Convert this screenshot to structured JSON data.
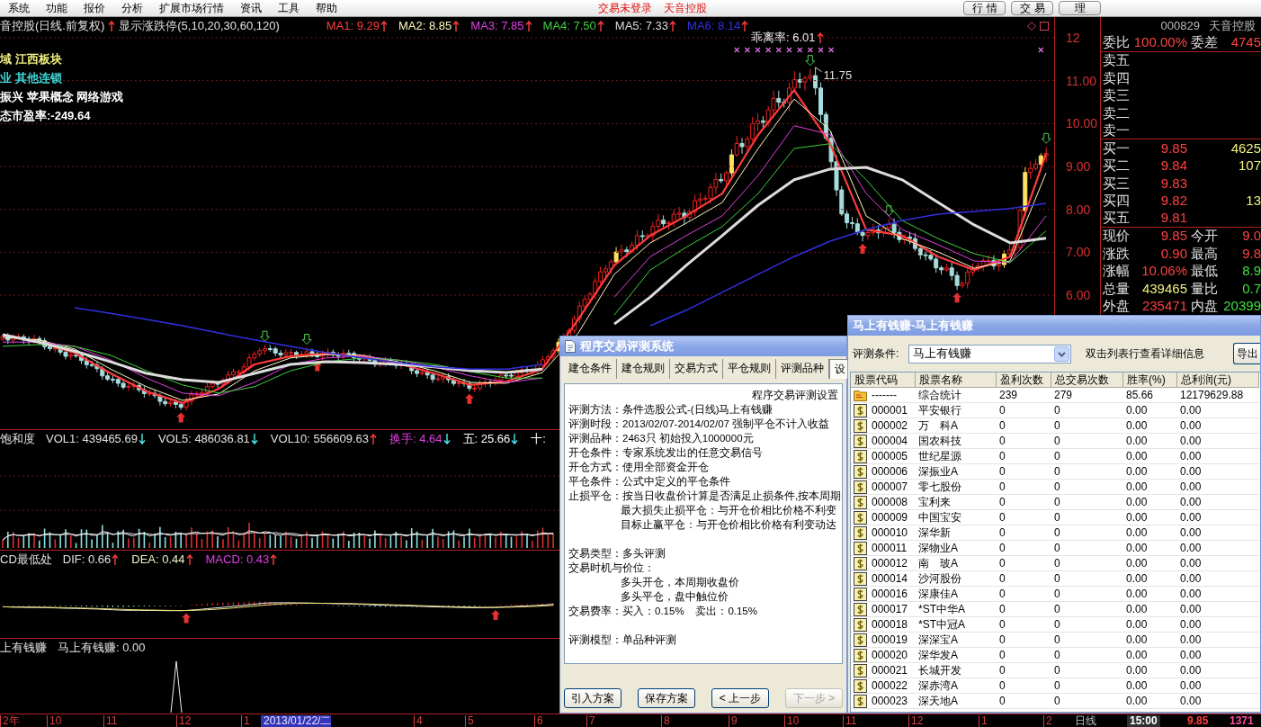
{
  "menu_bar": {
    "items": [
      "系统",
      "功能",
      "报价",
      "分析",
      "扩展市场行情",
      "资讯",
      "工具",
      "帮助"
    ],
    "notices": [
      "交易未登录",
      "天音控股"
    ],
    "buttons": [
      "行情",
      "交易",
      "理"
    ]
  },
  "chart": {
    "title": "音控股(日线.前复权)",
    "indicator_rising": true,
    "indicator": "显示涨跌停(5,10,20,30,60,120)",
    "moving_averages": [
      {
        "text": "MA1: 9.29",
        "rising": true,
        "color": "#ff3c3c"
      },
      {
        "text": "MA2: 8.85",
        "rising": true,
        "color": "#fff8c0"
      },
      {
        "text": "MA3: 7.85",
        "rising": true,
        "color": "#e040e0"
      },
      {
        "text": "MA4: 7.50",
        "rising": true,
        "color": "#40d040"
      },
      {
        "text": "MA5: 7.33",
        "rising": true,
        "color": "#dcdcdc"
      },
      {
        "text": "MA6: 8.14",
        "rising": true,
        "color": "#3030e0"
      }
    ],
    "info_lines": [
      {
        "text": "域 江西板块",
        "color": "#f0f080"
      },
      {
        "text": "业 其他连锁",
        "color": "#40d8d8"
      },
      {
        "text": "振兴 苹果概念 网络游戏",
        "color": "#ffffff"
      },
      {
        "text": "态市盈率:-249.64",
        "color": "#ffffff"
      }
    ],
    "bias": {
      "text": "乖离率: 6.01",
      "rising": true
    },
    "peak_label": "11.75",
    "chart_data": {
      "type": "line",
      "grid": true,
      "ylim": [
        2.88,
        12.48
      ],
      "yticks": [
        {
          "value": 12,
          "label": "12"
        },
        {
          "value": 11,
          "label": "11.00"
        },
        {
          "value": 10,
          "label": "10.00"
        },
        {
          "value": 9,
          "label": "9.00"
        },
        {
          "value": 8,
          "label": "8.00"
        },
        {
          "value": 7,
          "label": "7.00"
        },
        {
          "value": 6,
          "label": "6.00"
        }
      ],
      "series": [
        {
          "color": "#ff3c3c",
          "values": [
            5.08,
            4.91,
            4.66,
            4.18,
            3.76,
            3.49,
            3.82,
            4.39,
            4.58,
            4.64,
            4.58,
            4.41,
            4.18,
            3.91,
            3.99,
            4.28,
            5.44,
            6.7,
            7.39,
            7.85,
            8.37,
            9.74,
            10.78,
            9.53,
            7.53,
            7.39,
            6.9,
            6.59,
            6.9,
            9.29
          ]
        },
        {
          "color": "#fff8c0",
          "values": [
            5.02,
            4.96,
            4.75,
            4.28,
            3.87,
            3.55,
            3.7,
            4.24,
            4.54,
            4.62,
            4.6,
            4.45,
            4.24,
            3.97,
            3.95,
            4.2,
            5.12,
            6.49,
            7.22,
            7.68,
            8.16,
            9.42,
            10.57,
            9.84,
            7.85,
            7.32,
            7.01,
            6.63,
            6.8,
            8.85
          ]
        },
        {
          "color": "#e040e0",
          "values": [
            4.91,
            4.91,
            4.81,
            4.49,
            4.07,
            3.72,
            3.66,
            3.97,
            4.39,
            4.54,
            4.58,
            4.49,
            4.33,
            4.12,
            3.97,
            4.07,
            null,
            5.96,
            6.9,
            7.39,
            7.85,
            8.79,
            9.95,
            9.74,
            8.37,
            7.53,
            7.18,
            6.8,
            6.76,
            7.85
          ]
        },
        {
          "color": "#40d040",
          "values": [
            4.81,
            4.85,
            4.81,
            4.6,
            4.24,
            3.91,
            3.72,
            3.87,
            4.24,
            4.45,
            4.54,
            4.49,
            4.39,
            4.22,
            4.07,
            4.07,
            null,
            5.54,
            6.59,
            7.12,
            7.6,
            8.37,
            9.42,
            9.53,
            8.69,
            7.74,
            7.32,
            6.97,
            6.76,
            7.5
          ]
        },
        {
          "color": "#dcdcdc",
          "values": [
            5.08,
            4.91,
            4.7,
            4.45,
            4.18,
            4.03,
            3.97,
            4.18,
            4.39,
            4.45,
            4.43,
            4.39,
            4.33,
            4.24,
            4.2,
            4.28,
            null,
            5.33,
            5.96,
            6.7,
            7.39,
            8.1,
            8.69,
            8.94,
            8.98,
            8.69,
            8.16,
            7.64,
            7.22,
            7.33
          ]
        },
        {
          "color": "#3030e0",
          "values": [
            null,
            null,
            5.71,
            5.58,
            5.44,
            5.29,
            5.12,
            4.96,
            4.81,
            4.66,
            4.54,
            4.43,
            4.33,
            4.28,
            4.28,
            4.39,
            null,
            null,
            5.29,
            5.65,
            6.07,
            6.49,
            6.9,
            7.26,
            7.53,
            7.74,
            7.89,
            7.95,
            8.02,
            8.14
          ]
        }
      ]
    }
  },
  "volume_pane": {
    "title": "饱和度",
    "readouts": [
      {
        "text": "VOL1: 439465.69",
        "rising": false,
        "color": "#e0e0e0"
      },
      {
        "text": "VOL5: 486036.81",
        "rising": false,
        "color": "#e0e0e0"
      },
      {
        "text": "VOL10: 556609.63",
        "rising": true,
        "color": "#e0e0e0"
      },
      {
        "text": "换手: 4.64",
        "rising": false,
        "color": "#e040e0"
      },
      {
        "text": "五: 25.66",
        "rising": false,
        "color": "#ffffff"
      },
      {
        "text": "十:",
        "color": "#ffffff"
      }
    ]
  },
  "macd_pane": {
    "title": "CD最低处",
    "readouts": [
      {
        "text": "DIF: 0.66",
        "rising": true,
        "color": "#e0e0e0"
      },
      {
        "text": "DEA: 0.44",
        "rising": true,
        "color": "#f0f0c0"
      },
      {
        "text": "MACD: 0.43",
        "rising": true,
        "color": "#e040e0"
      }
    ]
  },
  "signal_pane": {
    "title": "上有钱赚",
    "readouts": [
      {
        "text": "马上有钱赚: 0.00",
        "color": "#e0e0e0"
      }
    ]
  },
  "quote_panel": {
    "code": "000829",
    "name": "天音控股",
    "order_ratio": [
      {
        "label": "委比",
        "value": "100.00%"
      },
      {
        "label": "委差",
        "value": "4745"
      }
    ],
    "asks": [
      "卖五",
      "卖四",
      "卖三",
      "卖二",
      "卖一"
    ],
    "bids": [
      {
        "label": "买一",
        "price": "9.85",
        "volume": "4625"
      },
      {
        "label": "买二",
        "price": "9.84",
        "volume": "107"
      },
      {
        "label": "买三",
        "price": "9.83"
      },
      {
        "label": "买四",
        "price": "9.82",
        "volume": "13"
      },
      {
        "label": "买五",
        "price": "9.81"
      }
    ],
    "stats": [
      {
        "label": "现价",
        "value": "9.85",
        "color": "#ff4040"
      },
      {
        "label": "今开",
        "value": "9.0",
        "color": "#ff4040"
      },
      {
        "label": "涨跌",
        "value": "0.90",
        "color": "#ff4040"
      },
      {
        "label": "最高",
        "value": "9.8",
        "color": "#ff4040"
      },
      {
        "label": "涨幅",
        "value": "10.06%",
        "color": "#ff4040"
      },
      {
        "label": "最低",
        "value": "8.9",
        "color": "#40e040"
      },
      {
        "label": "总量",
        "value": "439465",
        "color": "#f0f080"
      },
      {
        "label": "量比",
        "value": "0.7",
        "color": "#40e040"
      },
      {
        "label": "外盘",
        "value": "235471",
        "color": "#ff4040"
      },
      {
        "label": "内盘",
        "value": "20399",
        "color": "#40e040"
      }
    ]
  },
  "date_axis": {
    "labels": [
      {
        "text": "2年",
        "selected": false
      },
      {
        "text": "10",
        "selected": false
      },
      {
        "text": "11",
        "selected": false
      },
      {
        "text": "12",
        "selected": false
      },
      {
        "text": "1",
        "selected": false
      },
      {
        "text": "2013/01/22/二",
        "selected": true
      },
      {
        "text": "4",
        "selected": false
      },
      {
        "text": "5",
        "selected": false
      },
      {
        "text": "6",
        "selected": false
      },
      {
        "text": "7",
        "selected": false
      },
      {
        "text": "8",
        "selected": false
      },
      {
        "text": "9",
        "selected": false
      },
      {
        "text": "10",
        "selected": false
      },
      {
        "text": "11",
        "selected": false
      },
      {
        "text": "12",
        "selected": false
      },
      {
        "text": "1",
        "selected": false
      },
      {
        "text": "2",
        "selected": false
      }
    ],
    "status": {
      "period": "日线",
      "time": "15:00",
      "price": "9.85",
      "volume": "1371"
    }
  },
  "backtest_dialog": {
    "title": "程序交易评测系统",
    "tabs": [
      {
        "label": "建仓条件",
        "selected": false
      },
      {
        "label": "建仓规则",
        "selected": false
      },
      {
        "label": "交易方式",
        "selected": false
      },
      {
        "label": "平仓规则",
        "selected": false
      },
      {
        "label": "评测品种",
        "selected": false
      },
      {
        "label": "设",
        "selected": true
      }
    ],
    "report": {
      "title": "程序交易评测设置",
      "sections": [
        [
          {
            "text": "评测方法：条件选股公式-(日线)马上有钱赚"
          },
          {
            "text": "评测时段：2013/02/07-2014/02/07 强制平仓不计入收益"
          },
          {
            "text": "评测品种：2463只 初始投入1000000元"
          },
          {
            "text": "开仓条件：专家系统发出的任意交易信号"
          },
          {
            "text": "开仓方式：使用全部资金开仓"
          },
          {
            "text": "平仓条件：公式中定义的平仓条件"
          },
          {
            "text": "止损平仓：按当日收盘价计算是否满足止损条件,按本周期",
            "children": [
              {
                "text": "最大损失止损平仓：与开仓价相比价格不利变"
              },
              {
                "text": "目标止赢平仓：与开仓价相比价格有利变动达"
              }
            ]
          }
        ],
        [
          {
            "text": "交易类型：多头评测"
          },
          {
            "text": "交易时机与价位：",
            "children": [
              {
                "text": "多头开仓，本周期收盘价"
              },
              {
                "text": "多头平仓，盘中触位价"
              }
            ]
          },
          {
            "text": "交易费率：买入：0.15%    卖出：0.15%"
          }
        ],
        [
          {
            "text": "评测模型：单品种评测"
          }
        ]
      ]
    },
    "buttons": [
      {
        "label": "引入方案",
        "disabled": false
      },
      {
        "label": "保存方案",
        "disabled": false
      },
      {
        "label": "< 上一步",
        "disabled": false
      },
      {
        "label": "下一步 >",
        "disabled": true
      }
    ]
  },
  "results_window": {
    "title": "马上有钱赚-马上有钱赚",
    "filter": {
      "label": "评测条件:",
      "value": "马上有钱赚"
    },
    "hint": "双击列表行查看详细信息",
    "export_button": "导出",
    "columns": [
      "股票代码",
      "股票名称",
      "盈利次数",
      "总交易次数",
      "胜率(%)",
      "总利润(元)"
    ],
    "rows": [
      {
        "kind": "summary",
        "cells": [
          "-------",
          "综合统计",
          "239",
          "279",
          "85.66",
          "12179629.88"
        ]
      },
      {
        "kind": "stock",
        "cells": [
          "000001",
          "平安银行",
          "0",
          "0",
          "0.00",
          "0.00"
        ]
      },
      {
        "kind": "stock",
        "cells": [
          "000002",
          "万　科A",
          "0",
          "0",
          "0.00",
          "0.00"
        ]
      },
      {
        "kind": "stock",
        "cells": [
          "000004",
          "国农科技",
          "0",
          "0",
          "0.00",
          "0.00"
        ]
      },
      {
        "kind": "stock",
        "cells": [
          "000005",
          "世纪星源",
          "0",
          "0",
          "0.00",
          "0.00"
        ]
      },
      {
        "kind": "stock",
        "cells": [
          "000006",
          "深振业A",
          "0",
          "0",
          "0.00",
          "0.00"
        ]
      },
      {
        "kind": "stock",
        "cells": [
          "000007",
          "零七股份",
          "0",
          "0",
          "0.00",
          "0.00"
        ]
      },
      {
        "kind": "stock",
        "cells": [
          "000008",
          "宝利来",
          "0",
          "0",
          "0.00",
          "0.00"
        ]
      },
      {
        "kind": "stock",
        "cells": [
          "000009",
          "中国宝安",
          "0",
          "0",
          "0.00",
          "0.00"
        ]
      },
      {
        "kind": "stock",
        "cells": [
          "000010",
          "深华新",
          "0",
          "0",
          "0.00",
          "0.00"
        ]
      },
      {
        "kind": "stock",
        "cells": [
          "000011",
          "深物业A",
          "0",
          "0",
          "0.00",
          "0.00"
        ]
      },
      {
        "kind": "stock",
        "cells": [
          "000012",
          "南　玻A",
          "0",
          "0",
          "0.00",
          "0.00"
        ]
      },
      {
        "kind": "stock",
        "cells": [
          "000014",
          "沙河股份",
          "0",
          "0",
          "0.00",
          "0.00"
        ]
      },
      {
        "kind": "stock",
        "cells": [
          "000016",
          "深康佳A",
          "0",
          "0",
          "0.00",
          "0.00"
        ]
      },
      {
        "kind": "stock",
        "cells": [
          "000017",
          "*ST中华A",
          "0",
          "0",
          "0.00",
          "0.00"
        ]
      },
      {
        "kind": "stock",
        "cells": [
          "000018",
          "*ST中冠A",
          "0",
          "0",
          "0.00",
          "0.00"
        ]
      },
      {
        "kind": "stock",
        "cells": [
          "000019",
          "深深宝A",
          "0",
          "0",
          "0.00",
          "0.00"
        ]
      },
      {
        "kind": "stock",
        "cells": [
          "000020",
          "深华发A",
          "0",
          "0",
          "0.00",
          "0.00"
        ]
      },
      {
        "kind": "stock",
        "cells": [
          "000021",
          "长城开发",
          "0",
          "0",
          "0.00",
          "0.00"
        ]
      },
      {
        "kind": "stock",
        "cells": [
          "000022",
          "深赤湾A",
          "0",
          "0",
          "0.00",
          "0.00"
        ]
      },
      {
        "kind": "stock",
        "cells": [
          "000023",
          "深天地A",
          "0",
          "0",
          "0.00",
          "0.00"
        ]
      }
    ]
  }
}
